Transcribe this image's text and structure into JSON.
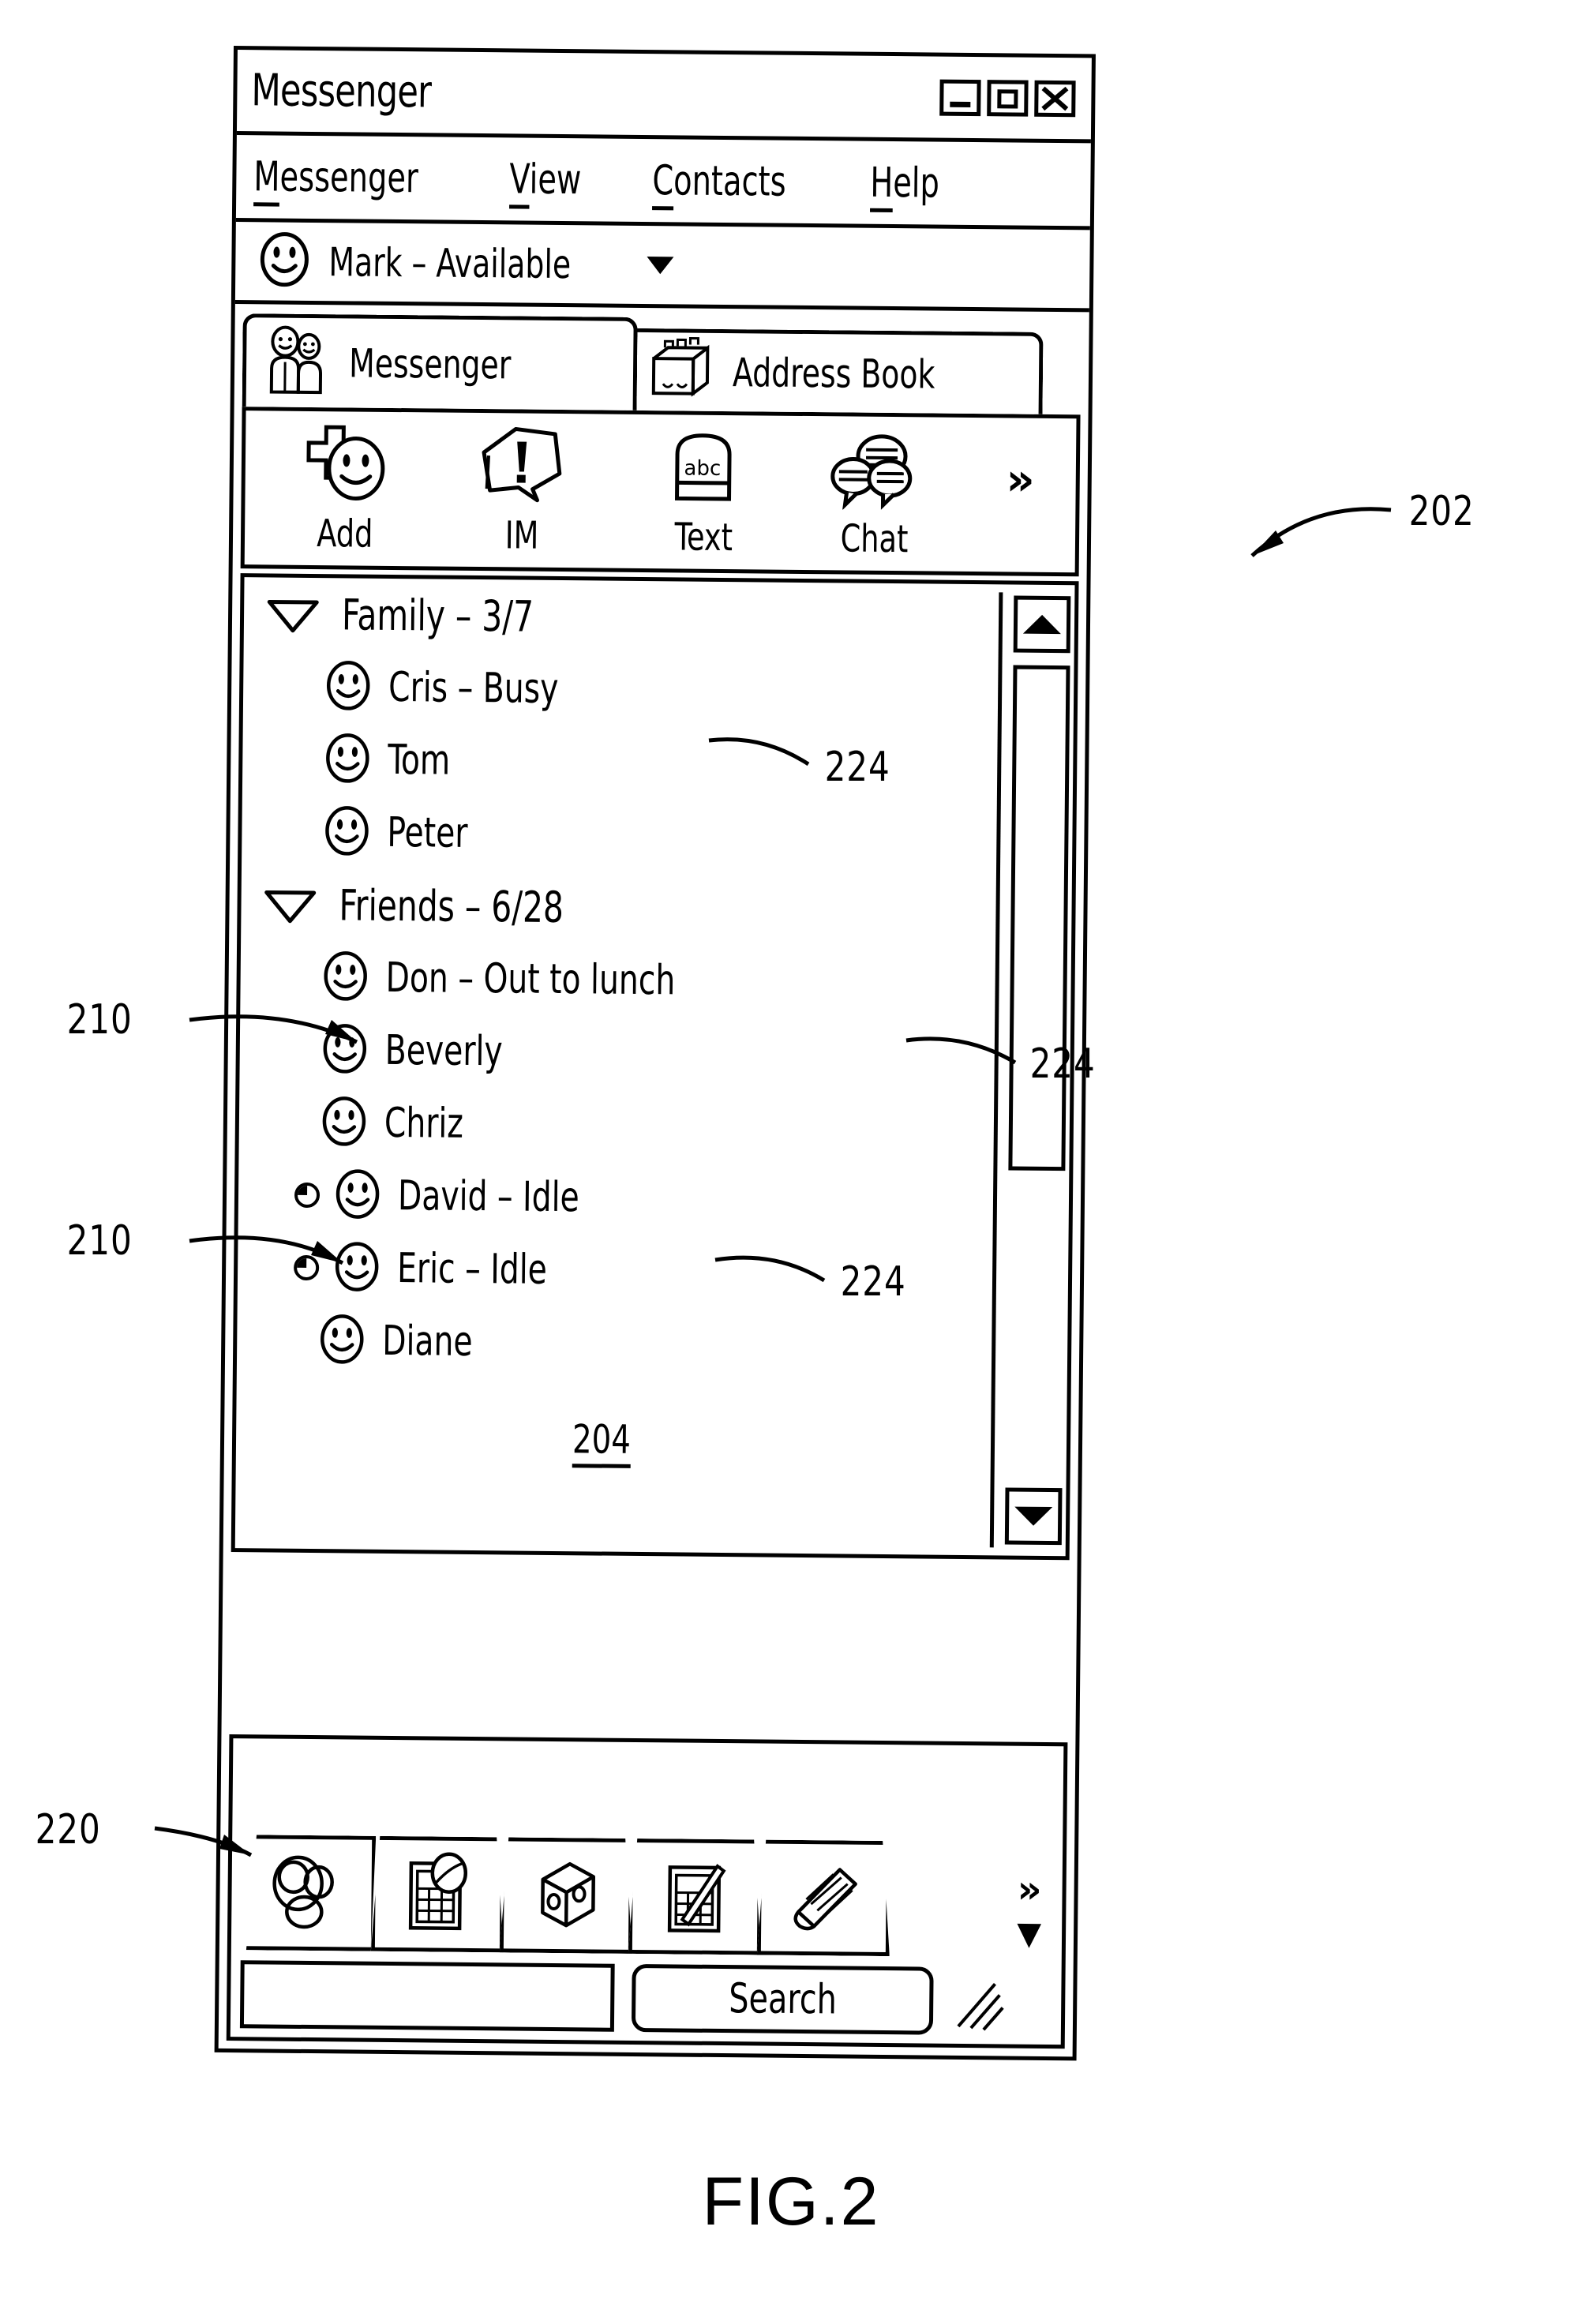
{
  "figure": {
    "caption": "FIG.2",
    "reference_numbers": {
      "window": "202",
      "contact_list": "204",
      "presence_icon_a": "210",
      "presence_icon_b": "210",
      "bottom_tabs": "220",
      "status_text_a": "224",
      "status_text_b": "224",
      "status_text_c": "224"
    }
  },
  "window": {
    "title": "Messenger",
    "controls": {
      "minimize": "minimize-icon",
      "maximize": "maximize-icon",
      "close": "close-icon"
    }
  },
  "menubar": {
    "items": [
      {
        "label": "Messenger",
        "accel": "M",
        "rest": "essenger"
      },
      {
        "label": "View",
        "accel": "V",
        "rest": "iew"
      },
      {
        "label": "Contacts",
        "accel": "C",
        "rest": "ontacts"
      },
      {
        "label": "Help",
        "accel": "H",
        "rest": "elp"
      }
    ]
  },
  "status": {
    "icon": "smiley-available-icon",
    "text": "Mark  –  Available",
    "dropdown": "chevron-down-icon"
  },
  "tabs": [
    {
      "label": "Messenger",
      "icon": "two-people-icon",
      "selected": true
    },
    {
      "label": "Address Book",
      "icon": "card-file-icon",
      "selected": false
    }
  ],
  "toolbar": {
    "buttons": [
      {
        "label": "Add",
        "icon": "add-contact-icon"
      },
      {
        "label": "IM",
        "icon": "instant-message-bubble-icon"
      },
      {
        "label": "Text",
        "icon": "abc-text-icon"
      },
      {
        "label": "Chat",
        "icon": "chat-balloons-icon"
      }
    ],
    "overflow": "»"
  },
  "contact_list": {
    "ref_label": "204",
    "groups": [
      {
        "name": "Family",
        "count": "3/7",
        "header_text": "Family  –  3/7",
        "expander": "triangle-down-icon",
        "contacts": [
          {
            "name": "Cris",
            "status": "Busy",
            "text": "Cris  –  Busy",
            "presence": "available-icon",
            "idle": false
          },
          {
            "name": "Tom",
            "status": "",
            "text": "Tom",
            "presence": "available-icon",
            "idle": false
          },
          {
            "name": "Peter",
            "status": "",
            "text": "Peter",
            "presence": "available-icon",
            "idle": false
          }
        ]
      },
      {
        "name": "Friends",
        "count": "6/28",
        "header_text": "Friends  –  6/28",
        "expander": "triangle-down-icon",
        "contacts": [
          {
            "name": "Don",
            "status": "Out to lunch",
            "text": "Don  –  Out to lunch",
            "presence": "available-icon",
            "idle": false
          },
          {
            "name": "Beverly",
            "status": "",
            "text": "Beverly",
            "presence": "available-icon",
            "idle": false
          },
          {
            "name": "Chriz",
            "status": "",
            "text": "Chriz",
            "presence": "available-icon",
            "idle": false
          },
          {
            "name": "David",
            "status": "Idle",
            "text": "David  –  Idle",
            "presence": "available-icon",
            "idle": true
          },
          {
            "name": "Eric",
            "status": "Idle",
            "text": "Eric  –  Idle",
            "presence": "available-icon",
            "idle": true
          },
          {
            "name": "Diane",
            "status": "",
            "text": "Diane",
            "presence": "available-icon",
            "idle": false
          }
        ]
      }
    ],
    "scrollbar": {
      "up": "scroll-up-arrow-icon",
      "down": "scroll-down-arrow-icon",
      "thumb": "scroll-thumb"
    }
  },
  "bottom_panel": {
    "tabs": [
      {
        "icon": "bowling-balls-icon"
      },
      {
        "icon": "calendar-ball-icon"
      },
      {
        "icon": "dice-box-icon"
      },
      {
        "icon": "chart-pencil-icon"
      },
      {
        "icon": "newspaper-icon"
      }
    ],
    "overflow_chevron": "»",
    "overflow_caret": "▼",
    "search": {
      "value": "",
      "placeholder": "",
      "button_label": "Search",
      "resize_grip": "resize-grip-icon"
    }
  }
}
